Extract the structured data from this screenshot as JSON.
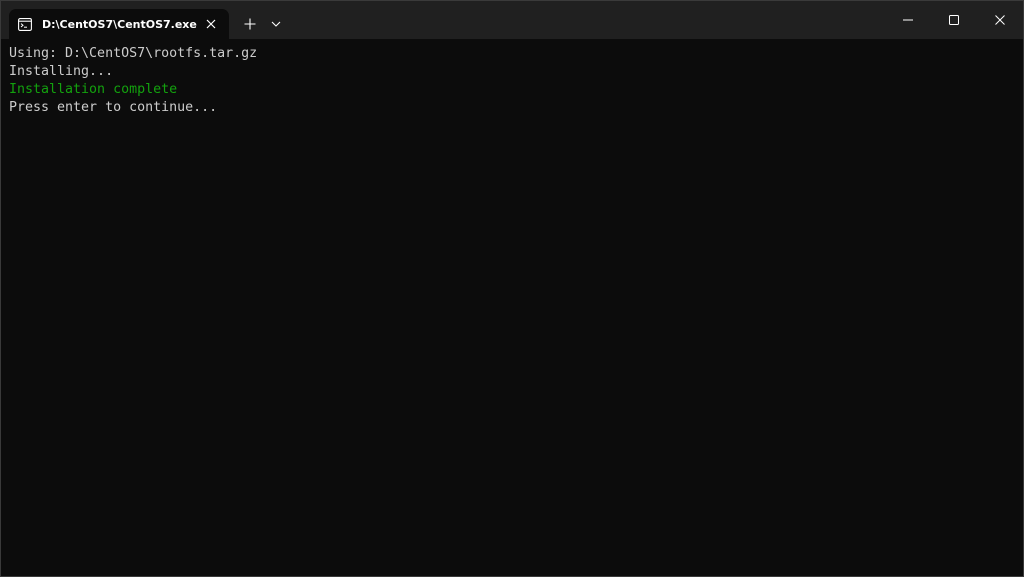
{
  "window": {
    "tab": {
      "title": "D:\\CentOS7\\CentOS7.exe",
      "icon": "console-icon"
    },
    "new_tab_icon": "plus-icon",
    "dropdown_icon": "chevron-down-icon",
    "caption": {
      "minimize_icon": "minimize-icon",
      "maximize_icon": "maximize-icon",
      "close_icon": "close-icon"
    }
  },
  "terminal": {
    "lines": [
      {
        "text": "Using: D:\\CentOS7\\rootfs.tar.gz",
        "kind": "normal"
      },
      {
        "text": "Installing...",
        "kind": "normal"
      },
      {
        "text": "Installation complete",
        "kind": "success"
      },
      {
        "text": "Press enter to continue...",
        "kind": "normal"
      }
    ]
  },
  "colors": {
    "background": "#0c0c0c",
    "titlebar": "#202020",
    "text": "#cccccc",
    "success": "#13a10e"
  }
}
